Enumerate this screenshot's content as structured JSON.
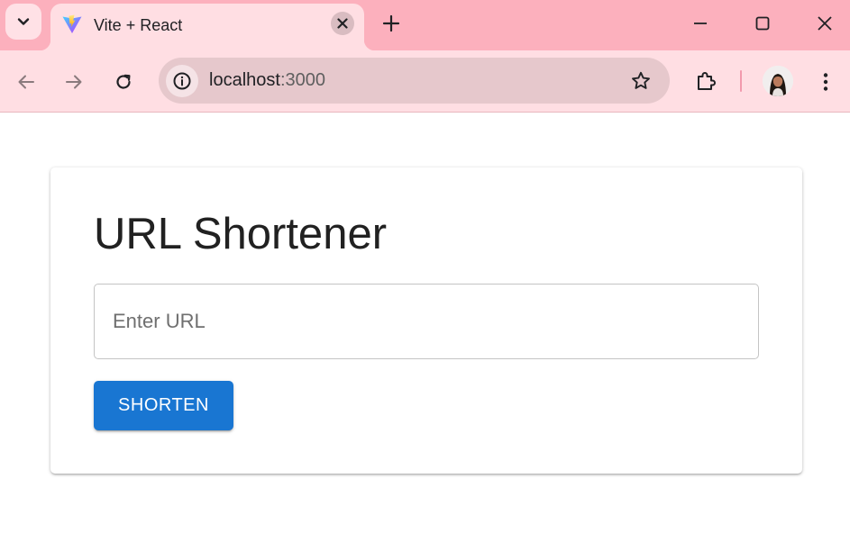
{
  "browser": {
    "tab": {
      "title": "Vite + React",
      "favicon": "vite-logo-icon"
    },
    "address": {
      "host": "localhost",
      "port": ":3000"
    },
    "colors": {
      "tabstrip": "#fcb0bd",
      "toolbar": "#ffdee3",
      "omnibox": "#e6c8cc"
    }
  },
  "page": {
    "title": "URL Shortener",
    "url_input": {
      "value": "",
      "placeholder": "Enter URL"
    },
    "shorten_button": {
      "label": "SHORTEN"
    },
    "colors": {
      "primary": "#1976d2",
      "title_text": "#212121"
    }
  }
}
